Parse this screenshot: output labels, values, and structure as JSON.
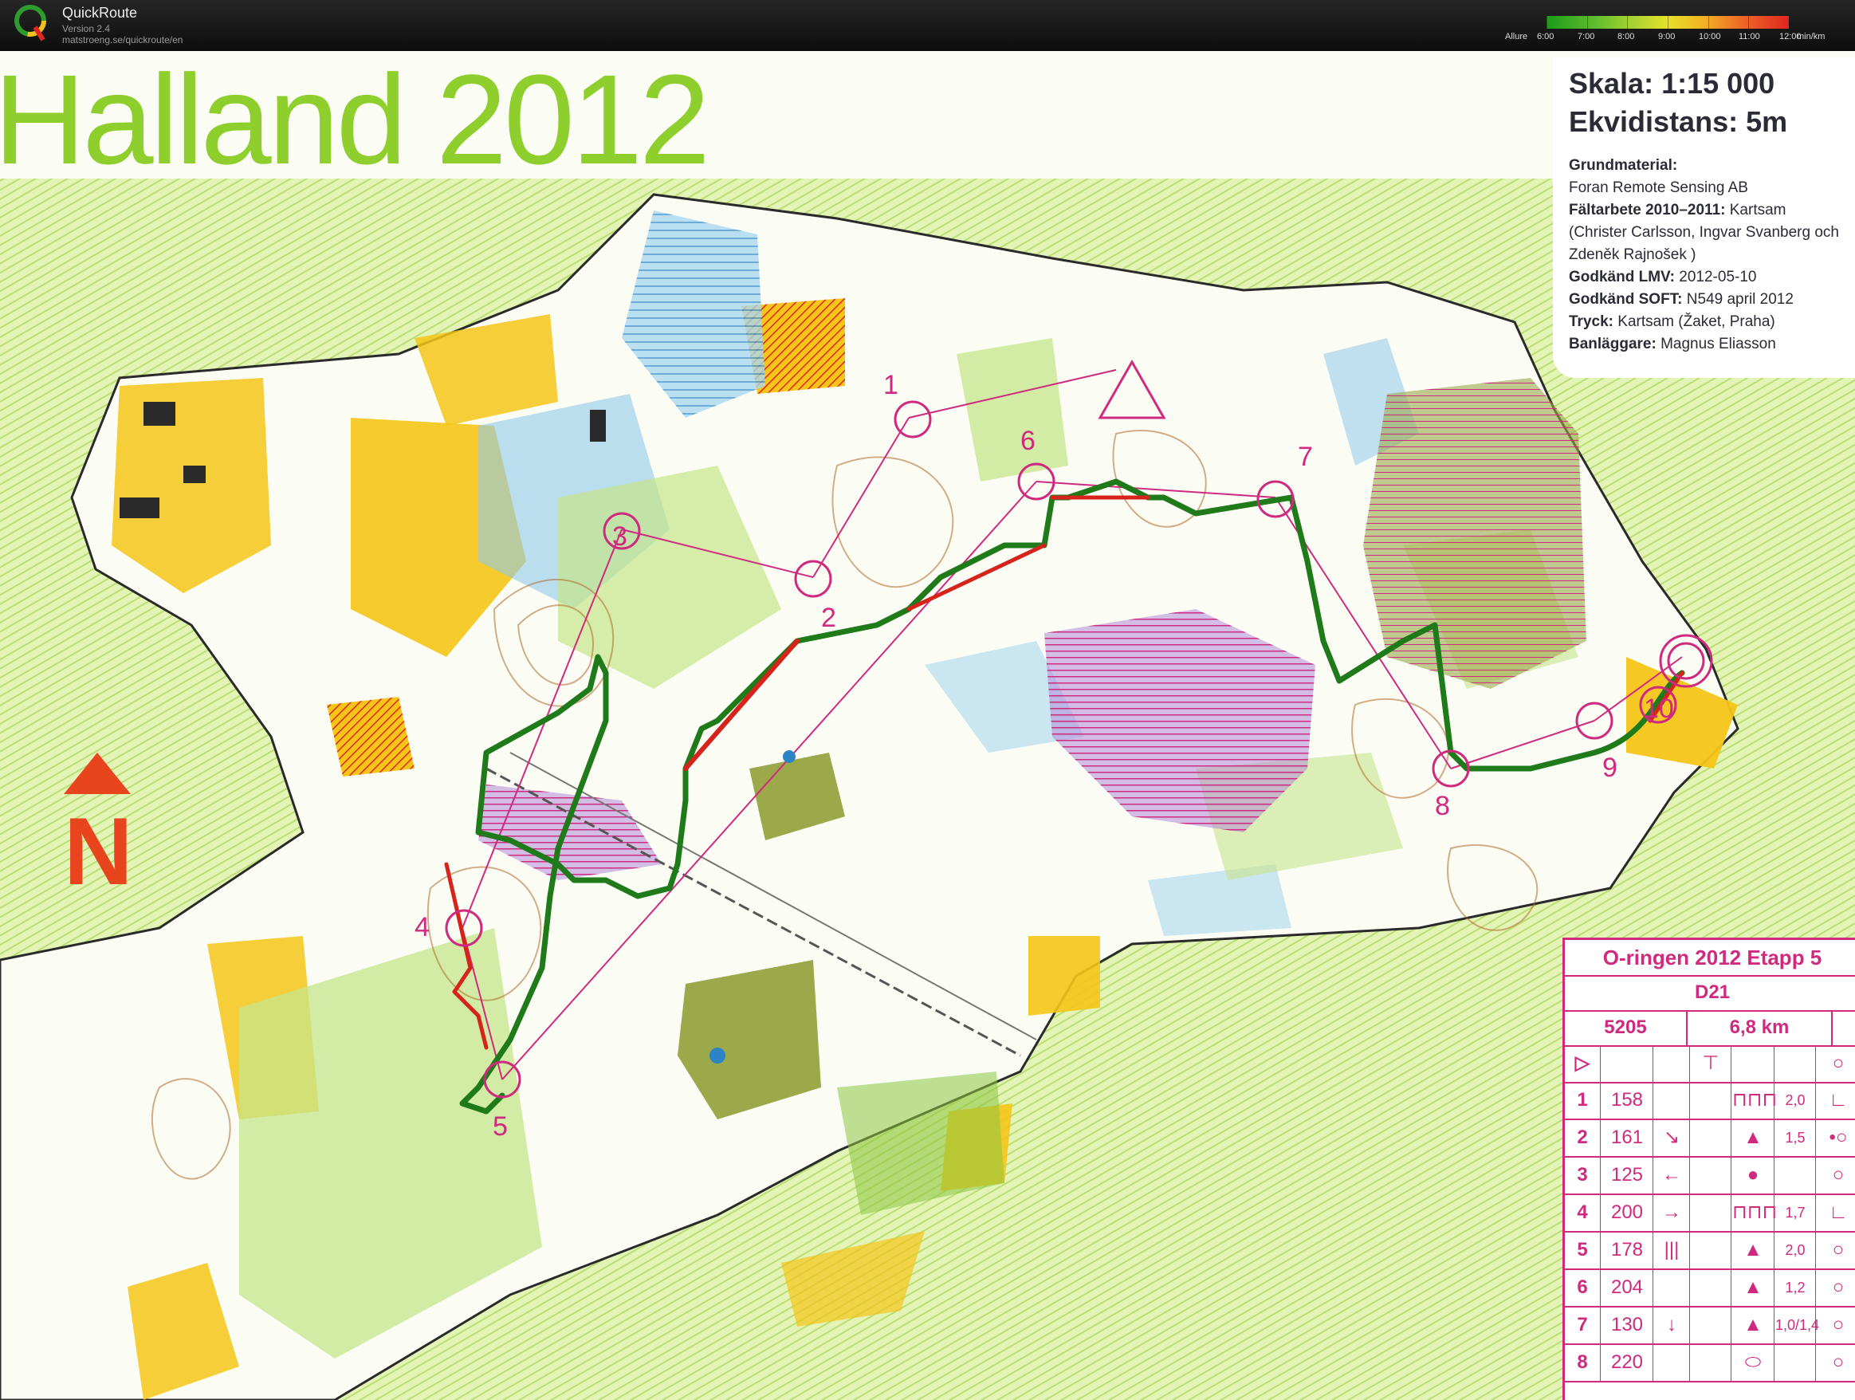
{
  "app": {
    "name": "QuickRoute",
    "version": "Version 2.4",
    "url": "matstroeng.se/quickroute/en"
  },
  "pace_legend": {
    "label": "Allure",
    "ticks": [
      "6:00",
      "7:00",
      "8:00",
      "9:00",
      "10:00",
      "11:00",
      "12:00"
    ],
    "unit": "min/km"
  },
  "map": {
    "title": "Halland 2012",
    "north_label": "N",
    "control_numbers": [
      "1",
      "2",
      "3",
      "4",
      "5",
      "6",
      "7",
      "8",
      "9",
      "10"
    ]
  },
  "info": {
    "scale": "Skala: 1:15 000",
    "equidistance": "Ekvidistans: 5m",
    "base_material_label": "Grundmaterial:",
    "base_material_value": "Foran Remote Sensing AB",
    "fieldwork_label": "Fältarbete 2010–2011:",
    "fieldwork_value": "Kartsam (Christer Carlsson, Ingvar Svanberg och Zdeněk Rajnošek )",
    "lmv_label": "Godkänd LMV:",
    "lmv_value": "2012-05-10",
    "soft_label": "Godkänd SOFT:",
    "soft_value": "N549 april 2012",
    "print_label": "Tryck:",
    "print_value": "Kartsam (Žaket, Praha)",
    "setter_label": "Banläggare:",
    "setter_value": "Magnus Eliasson"
  },
  "control_card": {
    "title": "O-ringen 2012 Etapp 5",
    "class": "D21",
    "course_code": "5205",
    "length": "6,8 km",
    "rows": [
      {
        "num": "1",
        "code": "158",
        "dir": "",
        "feature": "⊓⊓⊓",
        "dim": "2,0",
        "loc": "∟"
      },
      {
        "num": "2",
        "code": "161",
        "dir": "↘",
        "feature": "▲",
        "dim": "1,5",
        "loc": "•○"
      },
      {
        "num": "3",
        "code": "125",
        "dir": "←",
        "feature": "●",
        "dim": "",
        "loc": "○"
      },
      {
        "num": "4",
        "code": "200",
        "dir": "→",
        "feature": "⊓⊓⊓",
        "dim": "1,7",
        "loc": "∟"
      },
      {
        "num": "5",
        "code": "178",
        "dir": "|||",
        "feature": "▲",
        "dim": "2,0",
        "loc": "○"
      },
      {
        "num": "6",
        "code": "204",
        "dir": "",
        "feature": "▲",
        "dim": "1,2",
        "loc": "○"
      },
      {
        "num": "7",
        "code": "130",
        "dir": "↓",
        "feature": "▲",
        "dim": "1,0/1,4",
        "loc": "○"
      },
      {
        "num": "8",
        "code": "220",
        "dir": "",
        "feature": "⬭",
        "dim": "",
        "loc": "○"
      }
    ]
  },
  "colors": {
    "forest_white": "#fbfdf5",
    "light_green": "#c6e58a",
    "mid_green": "#8cc63f",
    "dark_green": "#3c8f2a",
    "open_yellow": "#f5c518",
    "marsh_blue": "#8fc9ea",
    "contour_brown": "#b26a2c",
    "course_magenta": "#cf2a7f",
    "route_green": "#1f7a1a",
    "route_red": "#d6231c"
  }
}
